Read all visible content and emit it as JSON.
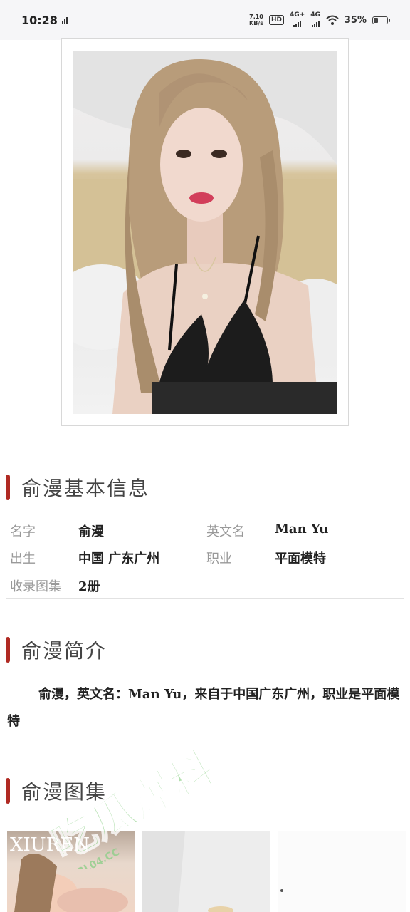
{
  "status_bar": {
    "time": "10:28",
    "net_speed": "7.10",
    "net_speed_unit": "KB/s",
    "hd_label": "HD",
    "sim1": "4G+",
    "sim2": "4G",
    "battery": "35%",
    "battery_level": 0.35
  },
  "profile": {
    "photo_alt": "俞漫"
  },
  "basic_info": {
    "title": "俞漫基本信息",
    "name_label": "名字",
    "name_value": "俞漫",
    "english_name_label": "英文名",
    "english_name_value": "Man Yu",
    "birth_label": "出生",
    "birth_value": "中国 广东广州",
    "job_label": "职业",
    "job_value": "平面模特",
    "albums_label": "收录图集",
    "albums_value": "2册"
  },
  "intro": {
    "title": "俞漫简介",
    "text": "俞漫，英文名：Man Yu，来自于中国广东广州，职业是平面模特"
  },
  "gallery": {
    "title": "俞漫图集",
    "thumb1_caption": "XIUREN"
  },
  "watermark": {
    "text": "吃瓜爆料",
    "url": "CGBL04.CC"
  }
}
